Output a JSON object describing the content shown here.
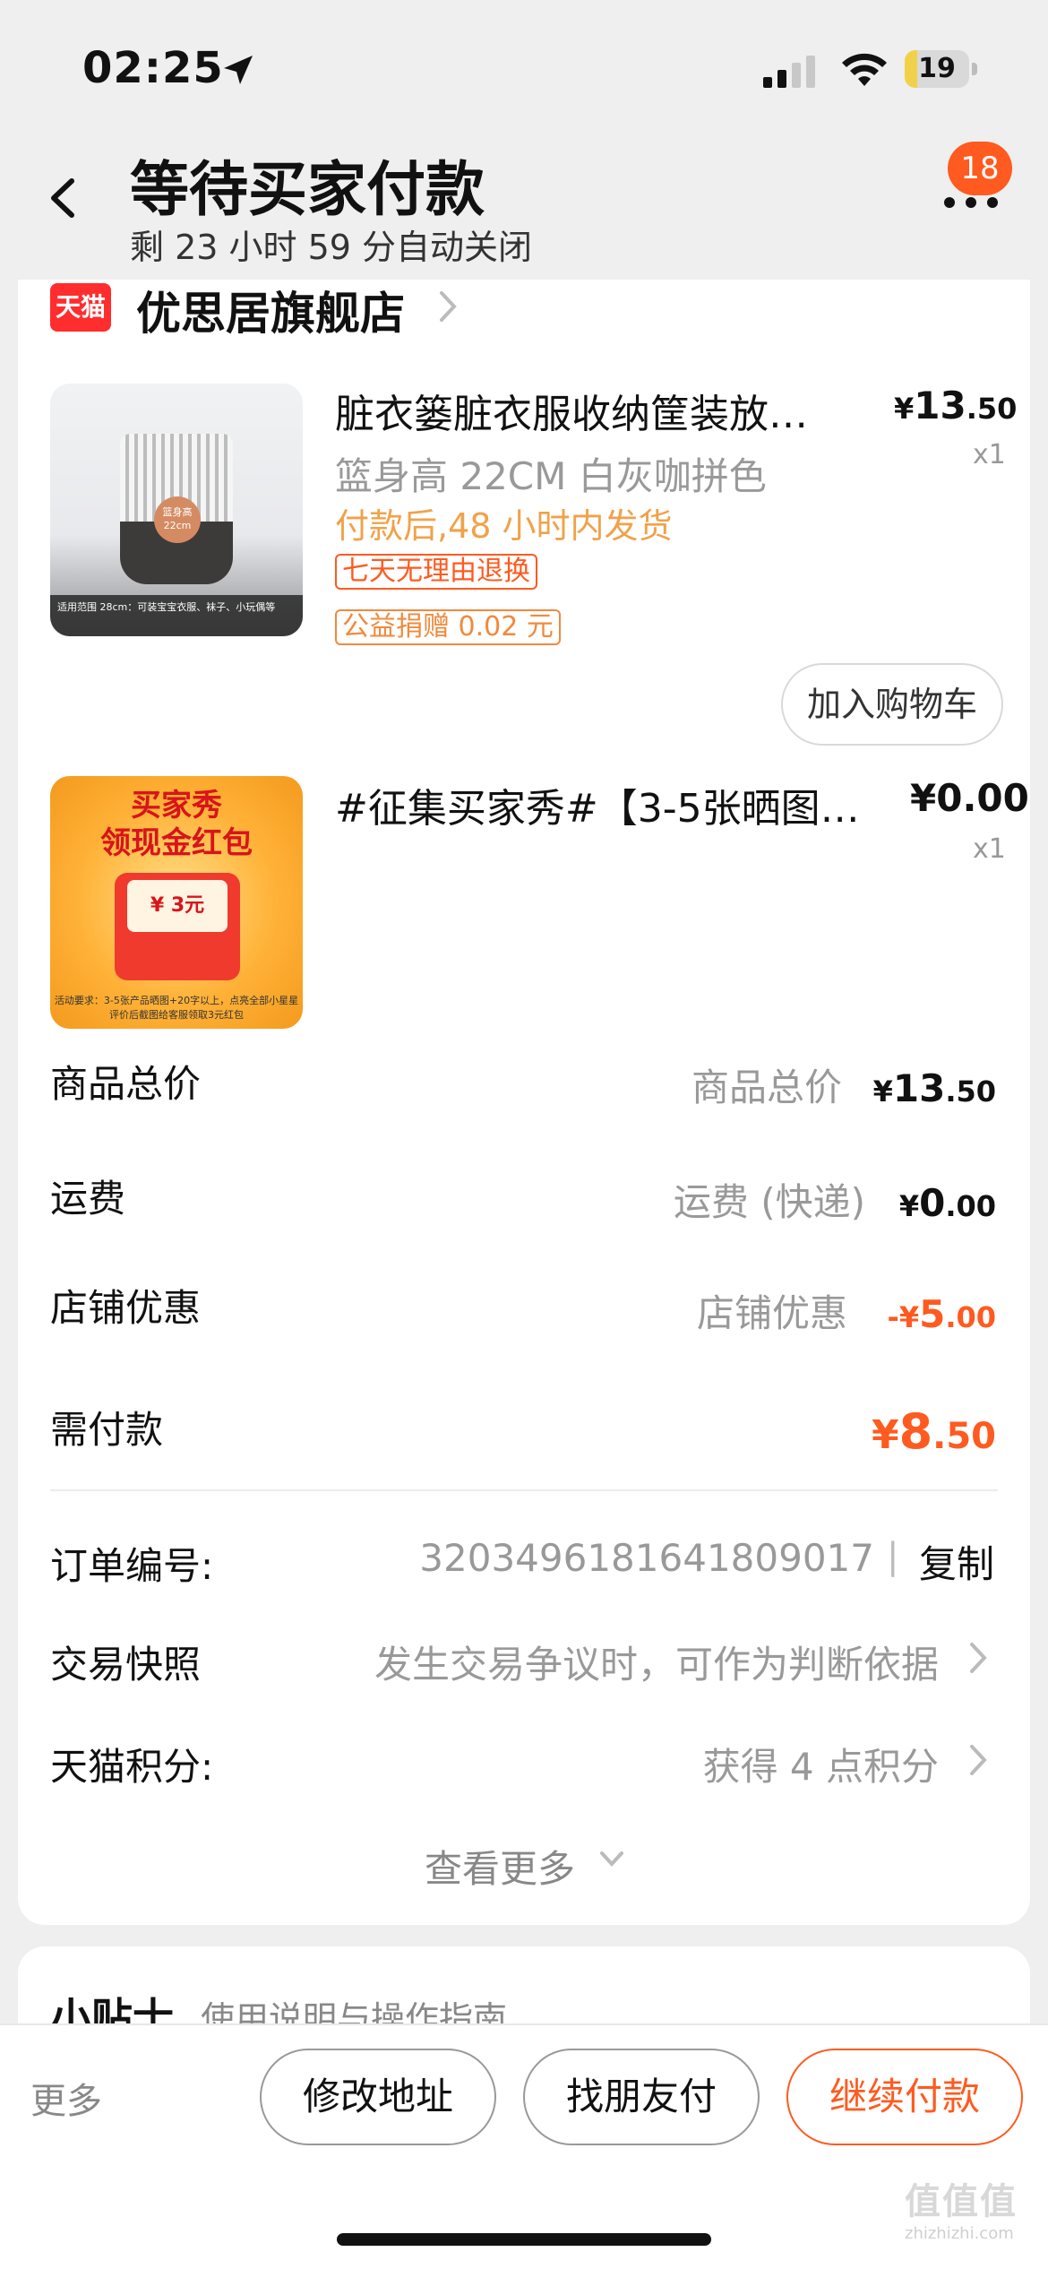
{
  "status_bar": {
    "time": "02:25",
    "battery": "19",
    "battery_level": 0.19
  },
  "header": {
    "title": "等待买家付款",
    "subtitle": "剩 23 小时 59 分自动关闭",
    "badge_count": "18"
  },
  "shop": {
    "platform_logo": "天猫",
    "name": "优思居旗舰店"
  },
  "items": [
    {
      "title": "脏衣篓脏衣服收纳筐装放…",
      "sku": "篮身高 22CM  白灰咖拼色",
      "shipping_note": "付款后,48 小时内发货",
      "tags": [
        "七天无理由退换",
        "公益捐赠 0.02 元"
      ],
      "price_currency": "¥",
      "price_int": "13",
      "price_dec": ".50",
      "qty": "x1",
      "action": "加入购物车",
      "thumb_caption": "适用范围 28cm：可装宝宝衣服、袜子、小玩偶等",
      "thumb_label": "篮身高 22cm"
    },
    {
      "title": "#征集买家秀#【3-5张晒图…",
      "price_currency": "¥",
      "price_int": "0",
      "price_dec": ".00",
      "qty": "x1",
      "thumb_heading_1": "买家秀",
      "thumb_heading_2": "领现金红包",
      "thumb_amount": "¥ 3元",
      "thumb_footer": "活动要求：3-5张产品晒图+20字以上，点亮全部小星星 评价后截图给客服领取3元红包"
    }
  ],
  "summary": {
    "rows": [
      {
        "label": "商品总价",
        "sub": "商品总价",
        "currency": "¥",
        "int": "13",
        "dec": ".50"
      },
      {
        "label": "运费",
        "sub": "运费 (快递)",
        "currency": "¥",
        "int": "0",
        "dec": ".00"
      },
      {
        "label": "店铺优惠",
        "sub": "店铺优惠",
        "currency": "-¥",
        "int": "5",
        "dec": ".00"
      },
      {
        "label": "需付款",
        "currency": "¥",
        "int": "8",
        "dec": ".50"
      }
    ]
  },
  "order_info": {
    "order_number_label": "订单编号:",
    "order_number": "3203496181641809017",
    "separator": "|",
    "copy_label": "复制",
    "snapshot_label": "交易快照",
    "snapshot_value": "发生交易争议时，可作为判断依据",
    "points_label": "天猫积分:",
    "points_value": "获得 4 点积分",
    "see_more": "查看更多"
  },
  "tips": {
    "title": "小贴士",
    "subtitle": "使用说明与操作指南"
  },
  "bottom_bar": {
    "more": "更多",
    "modify_address": "修改地址",
    "friend_pay": "找朋友付",
    "continue_pay": "继续付款"
  },
  "watermark": {
    "logo": "值值值",
    "domain": "zhizhizhi.com"
  },
  "colors": {
    "accent": "#ff5a1f",
    "tmall_red": "#ff2d2d",
    "shipping_note": "#f0a24a"
  }
}
